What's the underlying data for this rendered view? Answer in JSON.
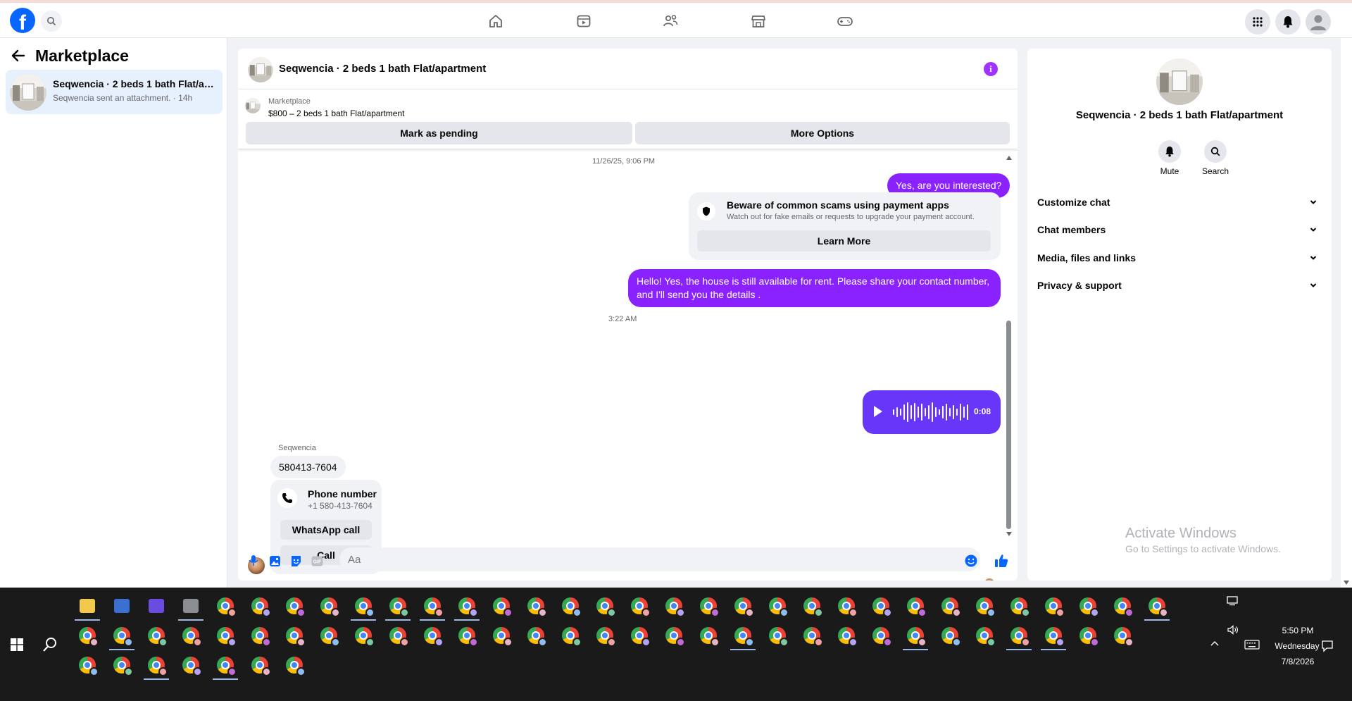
{
  "nav": {
    "logo": "f",
    "icons": [
      "home-icon",
      "video-icon",
      "friends-icon",
      "marketplace-icon",
      "gaming-icon"
    ],
    "right": [
      "apps-grid-icon",
      "notifications-icon",
      "profile-icon"
    ]
  },
  "sidebar": {
    "title": "Marketplace",
    "conversation": {
      "title": "Seqwencia · 2 beds 1 bath Flat/apa...",
      "subtitle": "Seqwencia sent an attachment. · 14h"
    }
  },
  "chat": {
    "title": "Seqwencia · 2 beds 1 bath Flat/apartment",
    "info_glyph": "i",
    "listing": {
      "source": "Marketplace",
      "summary": "$800 – 2 beds 1 bath Flat/apartment",
      "btn_pending": "Mark as pending",
      "btn_more": "More Options"
    },
    "messages": {
      "timestamp1": "11/26/25, 9:06 PM",
      "out1": "Yes, are you interested?",
      "scam_title": "Beware of common scams using payment apps",
      "scam_text": "Watch out for fake emails or requests to upgrade your payment account.",
      "scam_btn": "Learn More",
      "out2": "Hello! Yes, the house is still available for rent. Please share your contact number, and I'll send you the details .",
      "timestamp2": "3:22 AM",
      "voice_duration": "0:08",
      "sender": "Seqwencia",
      "in1": "580413-7604",
      "phone_title": "Phone number",
      "phone_number": "+1 580-413-7604",
      "btn_whatsapp": "WhatsApp call",
      "btn_call": "Call"
    },
    "composer": {
      "placeholder": "Aa",
      "icons": [
        "microphone-icon",
        "photo-icon",
        "sticker-icon",
        "gif-icon",
        "emoji-icon",
        "like-icon"
      ],
      "gif_label": "GIF"
    }
  },
  "right_panel": {
    "title": "Seqwencia · 2 beds 1 bath Flat/apartment",
    "mute": "Mute",
    "search": "Search",
    "sections": [
      "Customize chat",
      "Chat members",
      "Media, files and links",
      "Privacy & support"
    ]
  },
  "watermark": {
    "line1": "Activate Windows",
    "line2": "Go to Settings to activate Windows."
  },
  "taskbar": {
    "time": "5:50 PM",
    "day": "Wednesday",
    "date": "7/8/2026"
  },
  "colors": {
    "brand": "#0866ff",
    "outgoing": "#8a22ff",
    "voice": "#6836f8",
    "taskbar": "#1a1a1a"
  }
}
